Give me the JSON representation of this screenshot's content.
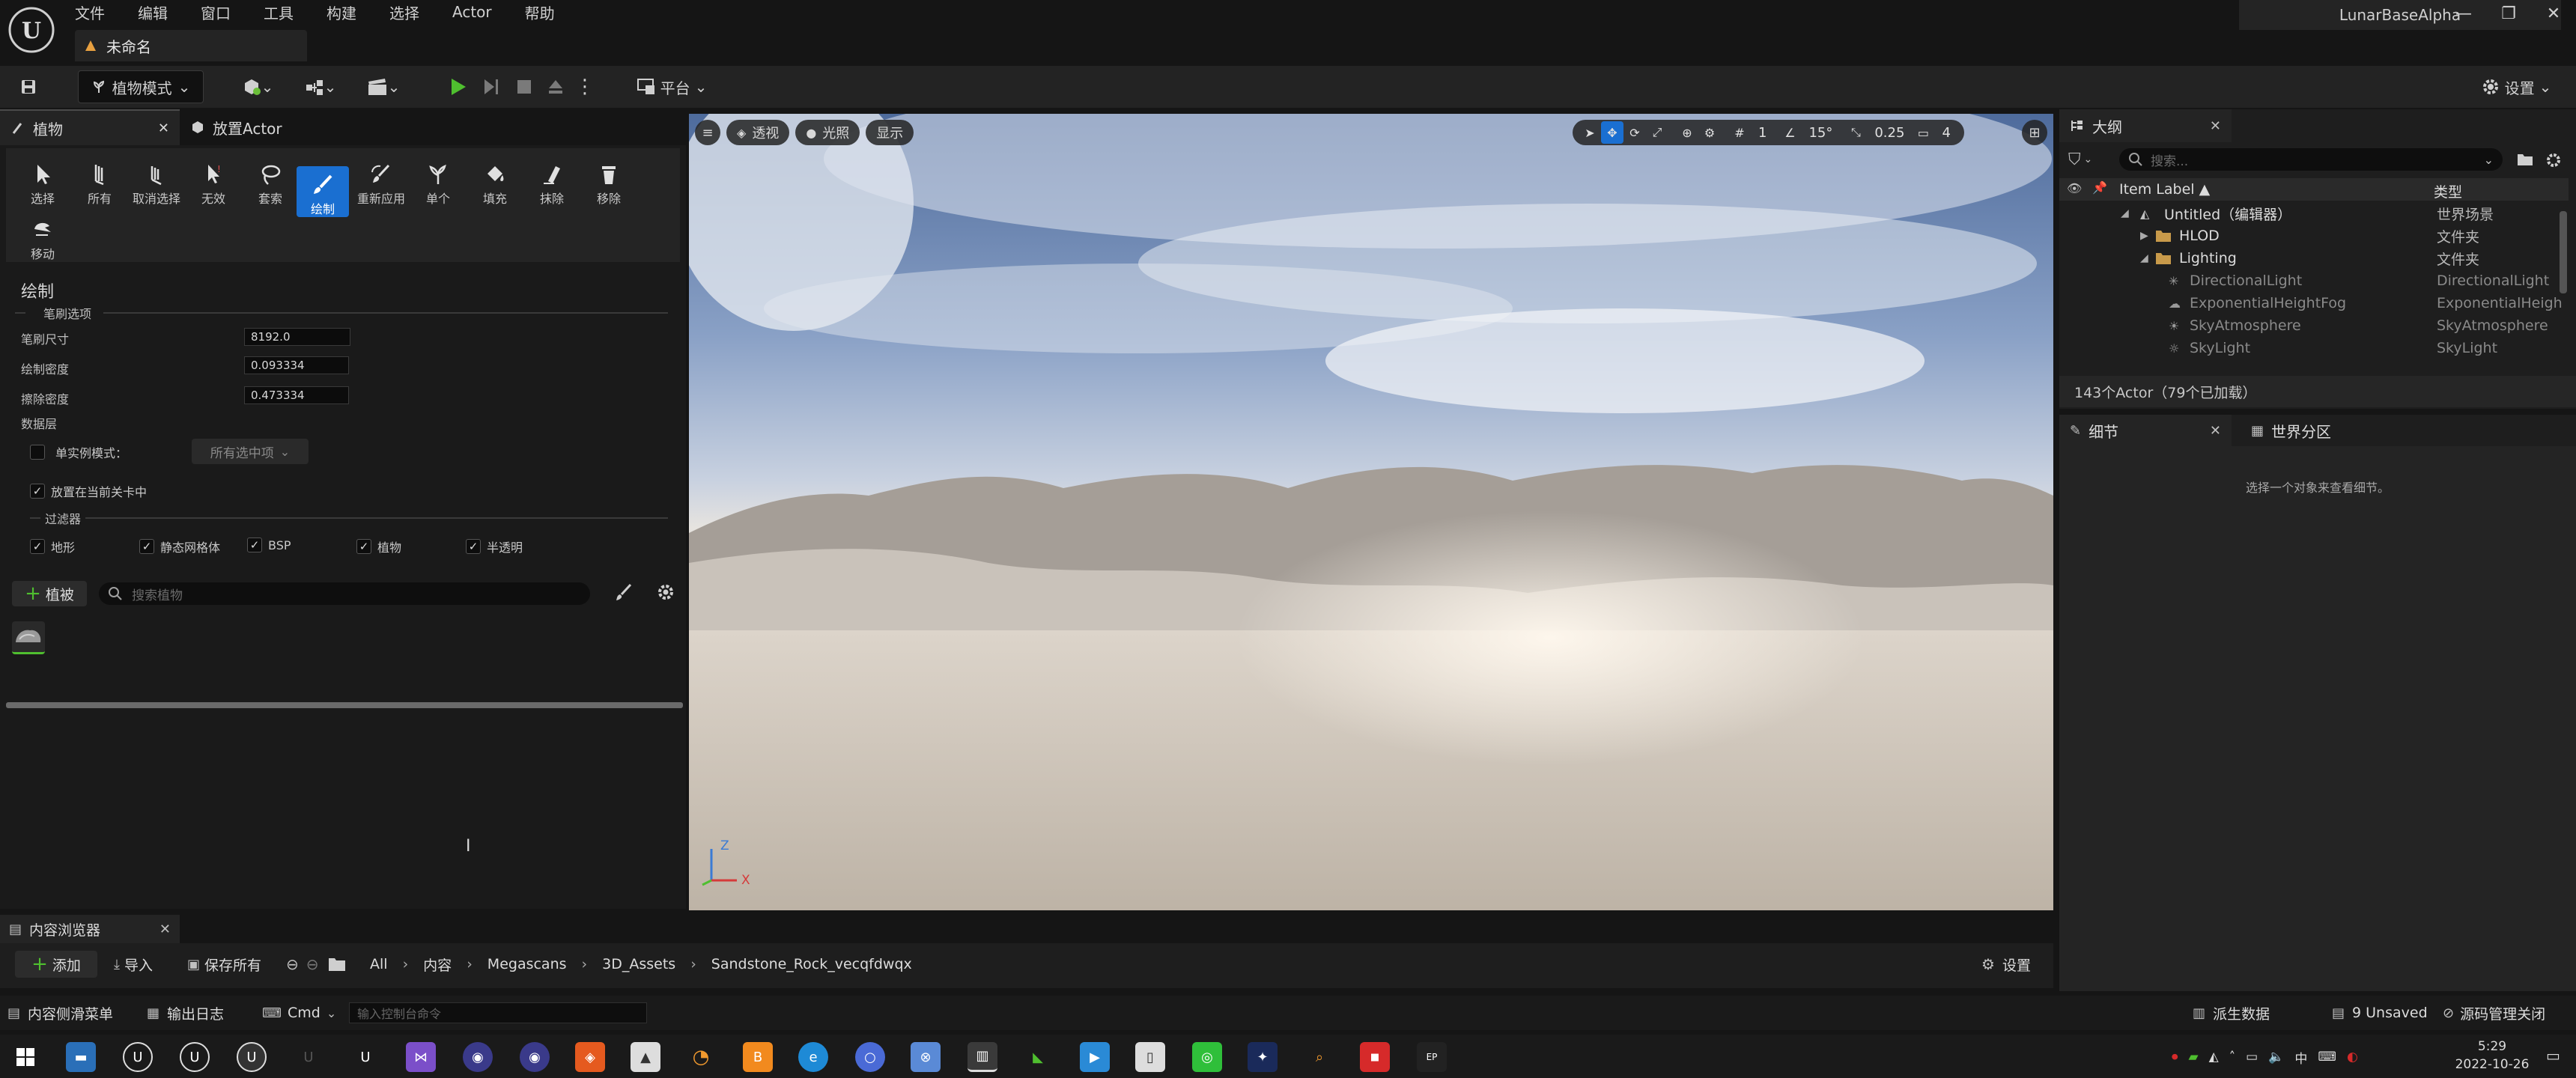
{
  "menu": [
    "文件",
    "编辑",
    "窗口",
    "工具",
    "构建",
    "选择",
    "Actor",
    "帮助"
  ],
  "doc_tab": "未命名",
  "project": "LunarBaseAlpha",
  "toolbar": {
    "mode": "植物模式",
    "platform": "平台",
    "settings": "设置"
  },
  "left_tabs": {
    "foliage": "植物",
    "place_actor": "放置Actor"
  },
  "tools": [
    {
      "label": "选择",
      "icon": "cursor-icon"
    },
    {
      "label": "所有",
      "icon": "select-all-icon"
    },
    {
      "label": "取消选择",
      "icon": "deselect-icon"
    },
    {
      "label": "无效",
      "icon": "invalid-icon"
    },
    {
      "label": "套索",
      "icon": "lasso-icon"
    },
    {
      "label": "绘制",
      "icon": "paint-brush-icon"
    },
    {
      "label": "重新应用",
      "icon": "reapply-icon"
    },
    {
      "label": "单个",
      "icon": "single-icon"
    },
    {
      "label": "填充",
      "icon": "fill-icon"
    },
    {
      "label": "抹除",
      "icon": "erase-icon"
    },
    {
      "label": "移除",
      "icon": "remove-icon"
    },
    {
      "label": "移动",
      "icon": "move-icon"
    }
  ],
  "paint": {
    "title": "绘制",
    "brush_section": "笔刷选项",
    "brush_size_label": "笔刷尺寸",
    "brush_size": "8192.0",
    "paint_density_label": "绘制密度",
    "paint_density": "0.093334",
    "erase_density_label": "擦除密度",
    "erase_density": "0.473334",
    "data_layer": "数据层",
    "single_instance_label": "单实例模式：",
    "single_instance_value": "所有选中项",
    "place_in_level": "放置在当前关卡中",
    "filter_section": "过滤器",
    "filters": [
      "地形",
      "静态网格体",
      "BSP",
      "植物",
      "半透明"
    ]
  },
  "foliage_list": {
    "add_label": "植被",
    "search_placeholder": "搜索植物"
  },
  "viewport": {
    "perspective": "透视",
    "lighting": "光照",
    "show": "显示",
    "grid": "1",
    "angle": "15°",
    "scale": "0.25",
    "camera_speed": "4",
    "axis_z": "Z",
    "axis_x": "X"
  },
  "outliner": {
    "tab": "大纲",
    "search_placeholder": "搜索...",
    "col_label": "Item Label ▲",
    "col_type": "类型",
    "rows": [
      {
        "name": "Untitled（编辑器）",
        "type": "世界场景"
      },
      {
        "name": "HLOD",
        "type": "文件夹"
      },
      {
        "name": "Lighting",
        "type": "文件夹"
      },
      {
        "name": "DirectionalLight",
        "type": "DirectionalLight"
      },
      {
        "name": "ExponentialHeightFog",
        "type": "ExponentialHeigh"
      },
      {
        "name": "SkyAtmosphere",
        "type": "SkyAtmosphere"
      },
      {
        "name": "SkyLight",
        "type": "SkyLight"
      }
    ],
    "summary": "143个Actor（79个已加载）"
  },
  "details": {
    "tab": "细节",
    "world_tab": "世界分区",
    "empty_msg": "选择一个对象来查看细节。"
  },
  "content_browser": {
    "tab": "内容浏览器",
    "add": "添加",
    "import": "导入",
    "save_all": "保存所有",
    "path": [
      "All",
      "内容",
      "Megascans",
      "3D_Assets",
      "Sandstone_Rock_vecqfdwqx"
    ],
    "settings": "设置"
  },
  "status": {
    "drawer": "内容侧滑菜单",
    "output": "输出日志",
    "cmd": "Cmd",
    "cmd_placeholder": "输入控制台命令",
    "derived": "派生数据",
    "unsaved": "9 Unsaved",
    "source_control": "源码管理关闭"
  },
  "taskbar": {
    "time": "5:29",
    "date": "2022-10-26",
    "ime": "中"
  }
}
